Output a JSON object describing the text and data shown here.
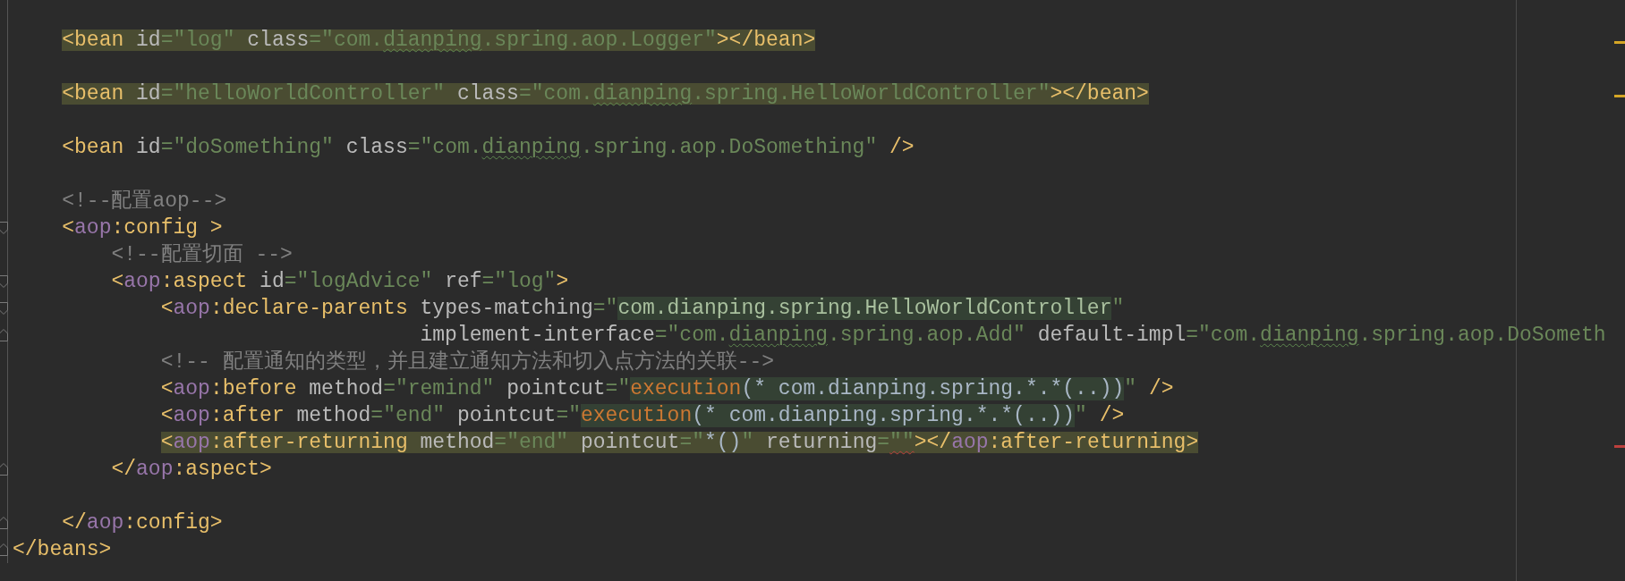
{
  "lines": [
    {
      "children": [
        {
          "kind": "blank",
          "highlighted": false,
          "warning": false,
          "error": false
        },
        {
          "kind": "line",
          "highlighted": true,
          "warning": true,
          "error": false,
          "tokens": [
            {
              "kind": "tag",
              "text": "<bean"
            },
            {
              "kind": "attr",
              "text": " id"
            },
            {
              "kind": "string",
              "text": "=\"log\""
            },
            {
              "kind": "attr",
              "text": " class"
            },
            {
              "kind": "string",
              "text": "=\"com."
            },
            {
              "kind": "typo",
              "text": "dianping"
            },
            {
              "kind": "string",
              "text": ".spring.aop.Logger\""
            },
            {
              "kind": "tag",
              "text": "></bean>"
            }
          ]
        },
        {
          "kind": "blank",
          "highlighted": false,
          "warning": false,
          "error": false
        },
        {
          "kind": "line",
          "highlighted": true,
          "warning": true,
          "error": false,
          "tokens": [
            {
              "kind": "tag",
              "text": "<bean"
            },
            {
              "kind": "attr",
              "text": " id"
            },
            {
              "kind": "string",
              "text": "=\"helloWorldController\""
            },
            {
              "kind": "attr",
              "text": " class"
            },
            {
              "kind": "string",
              "text": "=\"com."
            },
            {
              "kind": "typo",
              "text": "dianping"
            },
            {
              "kind": "string",
              "text": ".spring.HelloWorldController\""
            },
            {
              "kind": "tag",
              "text": "></bean>"
            }
          ]
        },
        {
          "kind": "blank",
          "highlighted": false,
          "warning": false,
          "error": false
        },
        {
          "kind": "line",
          "highlighted": false,
          "warning": false,
          "error": false,
          "tokens": [
            {
              "kind": "tag",
              "text": "<bean"
            },
            {
              "kind": "attr",
              "text": " id"
            },
            {
              "kind": "string",
              "text": "=\"doSomething\""
            },
            {
              "kind": "attr",
              "text": " class"
            },
            {
              "kind": "string",
              "text": "=\"com."
            },
            {
              "kind": "typo",
              "text": "dianping"
            },
            {
              "kind": "string",
              "text": ".spring.aop.DoSomething\""
            },
            {
              "kind": "tag",
              "text": " />"
            }
          ]
        },
        {
          "kind": "blank",
          "highlighted": false,
          "warning": false,
          "error": false
        },
        {
          "kind": "line",
          "highlighted": false,
          "warning": false,
          "error": false,
          "tokens": [
            {
              "kind": "comment",
              "text": "<!--配置aop-->"
            }
          ]
        },
        {
          "kind": "open",
          "highlighted": false,
          "warning": false,
          "error": false,
          "tokens": [
            {
              "kind": "tag",
              "text": "<"
            },
            {
              "kind": "ns",
              "text": "aop"
            },
            {
              "kind": "tag",
              "text": ":config >"
            }
          ],
          "children": [
            {
              "kind": "line",
              "highlighted": false,
              "warning": false,
              "error": false,
              "tokens": [
                {
                  "kind": "comment",
                  "text": "<!--配置切面 -->"
                }
              ]
            },
            {
              "kind": "open",
              "highlighted": false,
              "warning": false,
              "error": false,
              "tokens": [
                {
                  "kind": "tag",
                  "text": "<"
                },
                {
                  "kind": "ns",
                  "text": "aop"
                },
                {
                  "kind": "tag",
                  "text": ":aspect"
                },
                {
                  "kind": "attr",
                  "text": " id"
                },
                {
                  "kind": "string",
                  "text": "=\"logAdvice\""
                },
                {
                  "kind": "attr",
                  "text": " ref"
                },
                {
                  "kind": "string",
                  "text": "=\"log\""
                },
                {
                  "kind": "tag",
                  "text": ">"
                }
              ],
              "children": [
                {
                  "kind": "open",
                  "highlighted": false,
                  "warning": false,
                  "error": false,
                  "tokens": [
                    {
                      "kind": "tag",
                      "text": "<"
                    },
                    {
                      "kind": "ns",
                      "text": "aop"
                    },
                    {
                      "kind": "tag",
                      "text": ":declare-parents"
                    },
                    {
                      "kind": "attr",
                      "text": " types-matching"
                    },
                    {
                      "kind": "string",
                      "text": "=\""
                    },
                    {
                      "kind": "match",
                      "text": "com.dianping.spring.HelloWorldController"
                    },
                    {
                      "kind": "string",
                      "text": "\""
                    }
                  ],
                  "children": [
                    {
                      "kind": "continuation",
                      "highlighted": false,
                      "warning": false,
                      "error": false,
                      "tokens": [
                        {
                          "kind": "attr",
                          "text": "implement-interface"
                        },
                        {
                          "kind": "string",
                          "text": "=\"com."
                        },
                        {
                          "kind": "typo",
                          "text": "dianping"
                        },
                        {
                          "kind": "string",
                          "text": ".spring.aop.Add\""
                        },
                        {
                          "kind": "attr",
                          "text": " default-impl"
                        },
                        {
                          "kind": "string",
                          "text": "=\"com."
                        },
                        {
                          "kind": "typo",
                          "text": "dianping"
                        },
                        {
                          "kind": "string",
                          "text": ".spring.aop.DoSometh"
                        }
                      ]
                    }
                  ]
                },
                {
                  "kind": "line",
                  "highlighted": false,
                  "warning": false,
                  "error": false,
                  "tokens": [
                    {
                      "kind": "comment",
                      "text": "<!-- 配置通知的类型，并且建立通知方法和切入点方法的关联-->"
                    }
                  ]
                },
                {
                  "kind": "line",
                  "highlighted": false,
                  "warning": false,
                  "error": false,
                  "tokens": [
                    {
                      "kind": "tag",
                      "text": "<"
                    },
                    {
                      "kind": "ns",
                      "text": "aop"
                    },
                    {
                      "kind": "tag",
                      "text": ":before"
                    },
                    {
                      "kind": "attr",
                      "text": " method"
                    },
                    {
                      "kind": "string",
                      "text": "=\"remind\""
                    },
                    {
                      "kind": "attr",
                      "text": " pointcut"
                    },
                    {
                      "kind": "string",
                      "text": "=\""
                    },
                    {
                      "kind": "exec",
                      "text": "execution"
                    },
                    {
                      "kind": "call",
                      "text": "(* com.dianping.spring.*.*(..))"
                    },
                    {
                      "kind": "string",
                      "text": "\""
                    },
                    {
                      "kind": "tag",
                      "text": " />"
                    }
                  ]
                },
                {
                  "kind": "line",
                  "highlighted": false,
                  "warning": false,
                  "error": false,
                  "tokens": [
                    {
                      "kind": "tag",
                      "text": "<"
                    },
                    {
                      "kind": "ns",
                      "text": "aop"
                    },
                    {
                      "kind": "tag",
                      "text": ":after"
                    },
                    {
                      "kind": "attr",
                      "text": " method"
                    },
                    {
                      "kind": "string",
                      "text": "=\"end\""
                    },
                    {
                      "kind": "attr",
                      "text": " pointcut"
                    },
                    {
                      "kind": "string",
                      "text": "=\""
                    },
                    {
                      "kind": "exec",
                      "text": "execution"
                    },
                    {
                      "kind": "call",
                      "text": "(* com.dianping.spring.*.*(..))"
                    },
                    {
                      "kind": "string",
                      "text": "\""
                    },
                    {
                      "kind": "tag",
                      "text": " />"
                    }
                  ]
                },
                {
                  "kind": "line",
                  "highlighted": true,
                  "warning": false,
                  "error": true,
                  "tokens": [
                    {
                      "kind": "tag",
                      "text": "<"
                    },
                    {
                      "kind": "ns",
                      "text": "aop"
                    },
                    {
                      "kind": "tag",
                      "text": ":after-returning"
                    },
                    {
                      "kind": "attr",
                      "text": " method"
                    },
                    {
                      "kind": "string",
                      "text": "=\"end\""
                    },
                    {
                      "kind": "attr",
                      "text": " pointcut"
                    },
                    {
                      "kind": "string",
                      "text": "=\""
                    },
                    {
                      "kind": "plain",
                      "text": "*()"
                    },
                    {
                      "kind": "string",
                      "text": "\""
                    },
                    {
                      "kind": "attr",
                      "text": " returning"
                    },
                    {
                      "kind": "string",
                      "text": "="
                    },
                    {
                      "kind": "error",
                      "text": "\"\""
                    },
                    {
                      "kind": "tag",
                      "text": "></"
                    },
                    {
                      "kind": "ns",
                      "text": "aop"
                    },
                    {
                      "kind": "tag",
                      "text": ":after-returning>"
                    }
                  ]
                }
              ]
            },
            {
              "kind": "close",
              "highlighted": false,
              "warning": false,
              "error": false,
              "tokens": [
                {
                  "kind": "tag",
                  "text": "</"
                },
                {
                  "kind": "ns",
                  "text": "aop"
                },
                {
                  "kind": "tag",
                  "text": ":aspect>"
                }
              ]
            },
            {
              "kind": "blank",
              "highlighted": false,
              "warning": false,
              "error": false
            }
          ]
        },
        {
          "kind": "close",
          "highlighted": false,
          "warning": false,
          "error": false,
          "tokens": [
            {
              "kind": "tag",
              "text": "</"
            },
            {
              "kind": "ns",
              "text": "aop"
            },
            {
              "kind": "tag",
              "text": ":config>"
            }
          ]
        }
      ]
    },
    {
      "kind": "close",
      "highlighted": false,
      "warning": false,
      "error": false,
      "tokens": [
        {
          "kind": "tag",
          "text": "</beans>"
        }
      ]
    }
  ]
}
